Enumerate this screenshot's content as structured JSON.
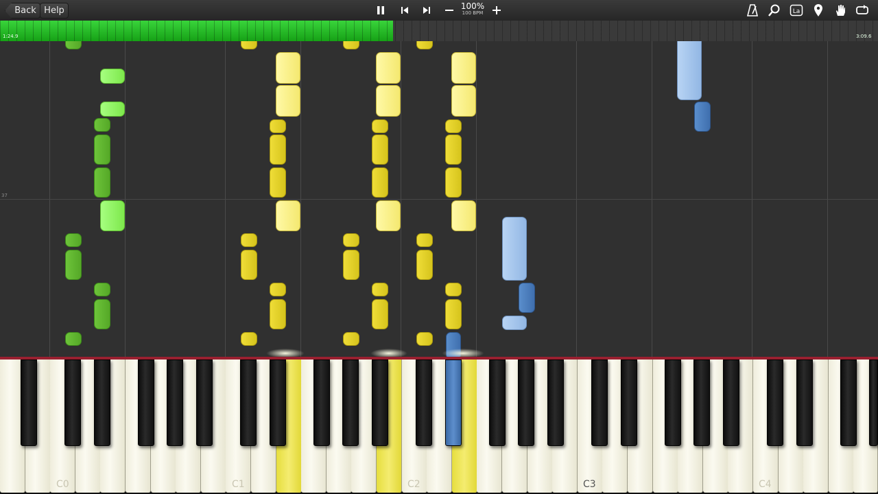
{
  "toolbar": {
    "back_label": "Back",
    "help_label": "Help",
    "speed_percent": "100%",
    "speed_bpm": "100 BPM",
    "icons": [
      "pause-icon",
      "previous-icon",
      "next-icon",
      "minus-icon",
      "plus-icon",
      "metronome-icon",
      "zoom-icon",
      "label-icon",
      "marker-icon",
      "hand-icon",
      "loop-icon"
    ],
    "label_icon_text": "La"
  },
  "timeline": {
    "current_time": "1:24.9",
    "total_time": "3:09.6",
    "progress": 0.448,
    "progress_color": "#22b622"
  },
  "roll": {
    "measure_number": "37"
  },
  "keyboard": {
    "octave_labels": [
      "C0",
      "C1",
      "C2",
      "C3",
      "C4"
    ]
  },
  "colors": {
    "right_hand_green": "#8ef060",
    "left_hand_yellow": "#e6d42a",
    "accent_blue": "#4a7cbc",
    "light_blue": "#a2c3ec"
  }
}
